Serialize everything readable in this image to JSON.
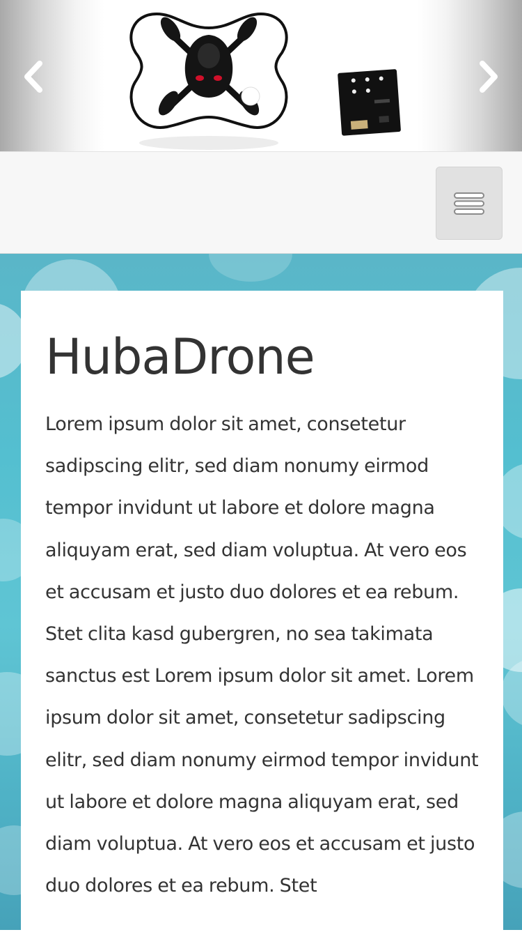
{
  "slider": {
    "prev_icon": "chevron-left-icon",
    "next_icon": "chevron-right-icon",
    "image": "drone-product-photo"
  },
  "navbar": {
    "menu_icon": "hamburger-menu-icon"
  },
  "colors": {
    "card_background": "#ffffff",
    "text": "#333333",
    "background_accent": "#54bfd0"
  },
  "content": {
    "title": "HubaDrone",
    "body": "Lorem ipsum dolor sit amet, consetetur sadipscing elitr, sed diam nonumy eirmod tempor invidunt ut labore et dolore magna aliquyam erat, sed diam voluptua. At vero eos et accusam et justo duo dolores et ea rebum. Stet clita kasd gubergren, no sea takimata sanctus est Lorem ipsum dolor sit amet. Lorem ipsum dolor sit amet, consetetur sadipscing elitr, sed diam nonumy eirmod tempor invidunt ut labore et dolore magna aliquyam erat, sed diam voluptua. At vero eos et accusam et justo duo dolores et ea rebum. Stet"
  }
}
